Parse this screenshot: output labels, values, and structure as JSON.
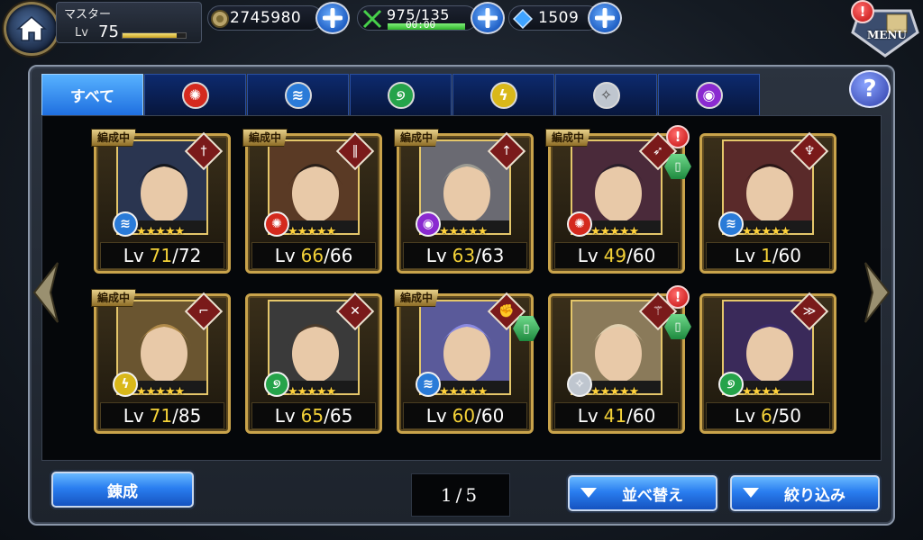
{
  "header": {
    "player_name": "マスター",
    "level_label": "Lv",
    "level_value": "75",
    "exp_fraction": 0.85,
    "gil": "2745980",
    "stamina": "975/135",
    "stamina_timer": "00:00",
    "stamina_fraction": 1.0,
    "gems": "1509",
    "menu_label": "MENU",
    "menu_alert": "!"
  },
  "tabs": [
    {
      "label": "すべて",
      "element": "all"
    },
    {
      "label": "",
      "element": "fire",
      "icon": "fire-element-icon"
    },
    {
      "label": "",
      "element": "water",
      "icon": "water-element-icon"
    },
    {
      "label": "",
      "element": "wind",
      "icon": "wind-element-icon"
    },
    {
      "label": "",
      "element": "thunder",
      "icon": "thunder-element-icon"
    },
    {
      "label": "",
      "element": "light",
      "icon": "light-element-icon"
    },
    {
      "label": "",
      "element": "dark",
      "icon": "dark-element-icon"
    }
  ],
  "help_label": "?",
  "party_tag": "編成中",
  "units": [
    {
      "lv_label": "Lv",
      "lv": "71",
      "max": "/72",
      "in_party": true,
      "element": "water",
      "weapon": "sword",
      "stars": 5,
      "alert": false,
      "book": false
    },
    {
      "lv_label": "Lv",
      "lv": "66",
      "max": "/66",
      "in_party": true,
      "element": "fire",
      "weapon": "greatsword",
      "stars": 5,
      "alert": false,
      "book": false
    },
    {
      "lv_label": "Lv",
      "lv": "63",
      "max": "/63",
      "in_party": true,
      "element": "dark",
      "weapon": "spear",
      "stars": 5,
      "alert": false,
      "book": false
    },
    {
      "lv_label": "Lv",
      "lv": "49",
      "max": "/60",
      "in_party": true,
      "element": "fire",
      "weapon": "bow",
      "stars": 5,
      "alert": true,
      "book": true
    },
    {
      "lv_label": "Lv",
      "lv": "1",
      "max": "/60",
      "in_party": false,
      "element": "water",
      "weapon": "staff",
      "stars": 5,
      "alert": false,
      "book": false
    },
    {
      "lv_label": "Lv",
      "lv": "71",
      "max": "/85",
      "in_party": true,
      "element": "thunder",
      "weapon": "gun",
      "stars": 5,
      "alert": false,
      "book": false
    },
    {
      "lv_label": "Lv",
      "lv": "65",
      "max": "/65",
      "in_party": false,
      "element": "wind",
      "weapon": "dagger",
      "stars": 5,
      "alert": false,
      "book": false
    },
    {
      "lv_label": "Lv",
      "lv": "60",
      "max": "/60",
      "in_party": true,
      "element": "water",
      "weapon": "fist",
      "stars": 5,
      "alert": false,
      "book": true
    },
    {
      "lv_label": "Lv",
      "lv": "41",
      "max": "/60",
      "in_party": false,
      "element": "light",
      "weapon": "rod",
      "stars": 5,
      "alert": true,
      "book": true
    },
    {
      "lv_label": "Lv",
      "lv": "6",
      "max": "/50",
      "in_party": false,
      "element": "wind",
      "weapon": "claw",
      "stars": 4,
      "alert": false,
      "book": false
    }
  ],
  "footer": {
    "craft_label": "錬成",
    "page_current": "1",
    "page_sep": "/",
    "page_total": "5",
    "sort_label": "並べ替え",
    "filter_label": "絞り込み"
  },
  "colors": {
    "fire": "#d42a1e",
    "water": "#2a7bd8",
    "wind": "#25a34a",
    "thunder": "#d9b81a",
    "light": "#bfc6cf",
    "dark": "#8a2ad0",
    "gold_frame": "#c9a34b",
    "level_highlight": "#f4d238"
  }
}
